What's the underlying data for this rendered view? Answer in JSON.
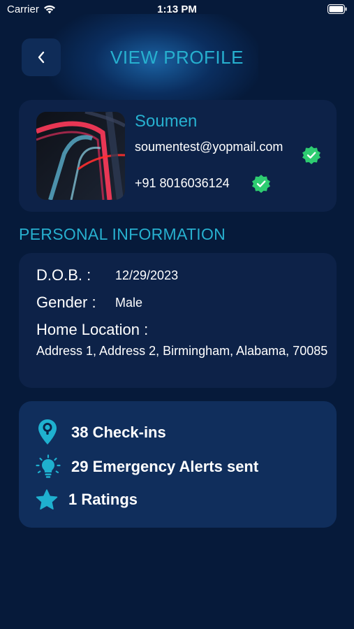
{
  "status_bar": {
    "carrier": "Carrier",
    "time": "1:13 PM"
  },
  "header": {
    "back_icon": "chevron-left-icon",
    "title": "VIEW PROFILE"
  },
  "profile": {
    "name": "Soumen",
    "email": "soumentest@yopmail.com",
    "phone": "+91 8016036124",
    "email_verified_icon": "verified-badge-icon",
    "phone_verified_icon": "verified-badge-icon"
  },
  "personal_information": {
    "section_title": "PERSONAL INFORMATION",
    "dob_label": "D.O.B. :",
    "dob_value": "12/29/2023",
    "gender_label": "Gender :",
    "gender_value": "Male",
    "home_location_label": "Home Location :",
    "home_location_value": "Address 1, Address 2, Birmingham, Alabama, 70085"
  },
  "stats": [
    {
      "icon": "location-pin-icon",
      "text": "38 Check-ins"
    },
    {
      "icon": "lightbulb-icon",
      "text": "29 Emergency Alerts sent"
    },
    {
      "icon": "star-icon",
      "text": "1 Ratings"
    }
  ],
  "colors": {
    "background": "#061a3a",
    "card": "#0d2248",
    "accent": "#27b0cf",
    "verified": "#2ecc71"
  }
}
